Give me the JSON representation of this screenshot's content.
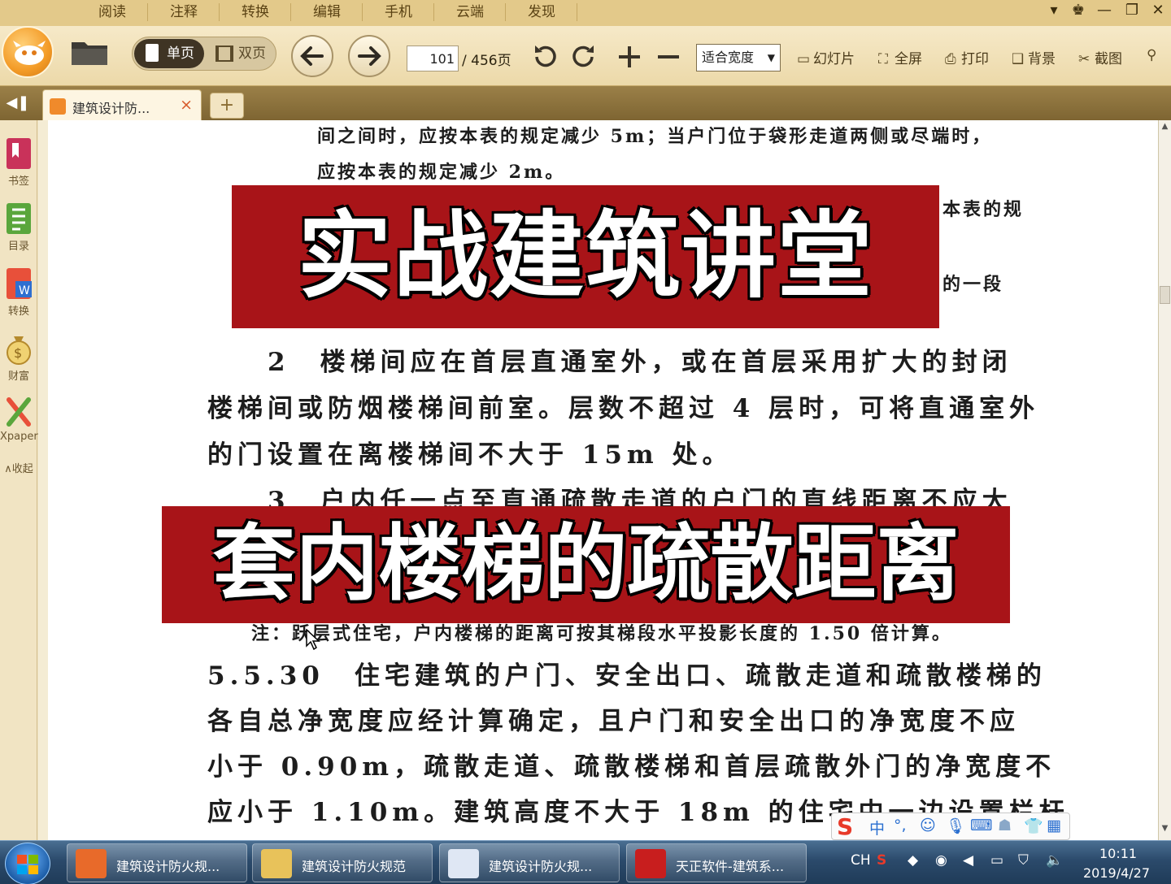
{
  "menu": {
    "tabs": [
      "阅读",
      "注释",
      "转换",
      "编辑",
      "手机",
      "云端",
      "发现"
    ]
  },
  "toolbar": {
    "single_page": "单页",
    "double_page": "双页",
    "current_page": "101",
    "page_total": "/ 456页",
    "zoom": "适合宽度",
    "slideshow": "幻灯片",
    "fullscreen": "全屏",
    "print": "打印",
    "background": "背景",
    "screenshot": "截图"
  },
  "tabs": {
    "doc_tab": "建筑设计防...",
    "close": "×",
    "new": "+"
  },
  "sidebar": {
    "items": [
      "书签",
      "目录",
      "转换",
      "财富",
      "Xpaper"
    ],
    "collapse": "∧收起"
  },
  "document": {
    "lines": [
      "间之间时，应按本表的规定减少 5m；当户门位于袋形走道两侧或尽端时，",
      "应按本表的规定减少 2m。",
      "本表的规",
      "的一段",
      "2　楼梯间应在首层直通室外，或在首层采用扩大的封闭",
      "楼梯间或防烟楼梯间前室。层数不超过 4 层时，可将直通室外",
      "的门设置在离楼梯间不大于 15m 处。",
      "3　户内任一点至直通疏散走道的户门的直线距离不应大",
      "注：跃层式住宅，户内楼梯的距离可按其梯段水平投影长度的 1.50 倍计算。",
      "5.5.30　住宅建筑的户门、安全出口、疏散走道和疏散楼梯的",
      "各自总净宽度应经计算确定，且户门和安全出口的净宽度不应",
      "小于 0.90m，疏散走道、疏散楼梯和首层疏散外门的净宽度不",
      "应小于 1.10m。建筑高度不大于 18m 的住宅中一边设置栏杆"
    ]
  },
  "banners": {
    "top": "实战建筑讲堂",
    "bottom": "套内楼梯的疏散距离"
  },
  "ime": {
    "label": "中"
  },
  "taskbar": {
    "tasks": [
      "建筑设计防火规...",
      "建筑设计防火规范",
      "建筑设计防火规...",
      "天正软件-建筑系..."
    ],
    "lang": "CH",
    "time": "10:11",
    "date": "2019/4/27"
  },
  "colors": {
    "banner_red": "#a81418",
    "menu_bar": "#e3c98a",
    "tabstrip": "#8a6f3c",
    "taskbar": "#2b4a6b"
  }
}
